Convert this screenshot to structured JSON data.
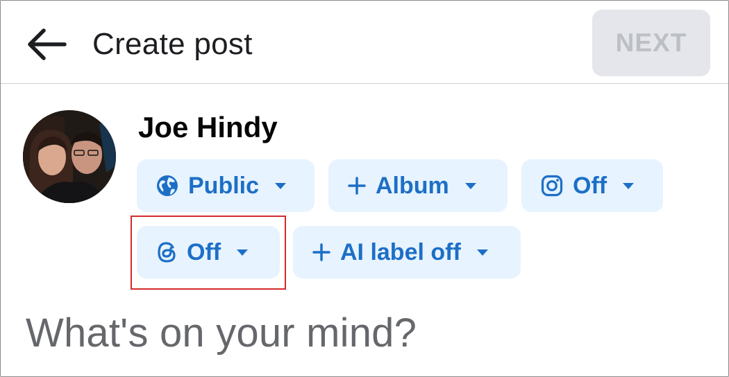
{
  "header": {
    "back_icon": "arrow-left-icon",
    "title": "Create post",
    "next_label": "NEXT"
  },
  "profile": {
    "name": "Joe Hindy",
    "avatar_icon": "profile-photo"
  },
  "audience_chips": [
    {
      "icon": "globe-icon",
      "label": "Public",
      "caret": "caret-down-icon"
    },
    {
      "icon": "plus-icon",
      "label": "Album",
      "caret": "caret-down-icon"
    },
    {
      "icon": "instagram-icon",
      "label": "Off",
      "caret": "caret-down-icon"
    },
    {
      "icon": "threads-icon",
      "label": "Off",
      "caret": "caret-down-icon"
    },
    {
      "icon": "plus-icon",
      "label": "AI label off",
      "caret": "caret-down-icon"
    }
  ],
  "composer": {
    "placeholder": "What's on your mind?"
  },
  "colors": {
    "chip_background": "#e7f3ff",
    "chip_text": "#1d6fc6",
    "next_background": "#e4e6eb",
    "next_text": "#bcc0c4",
    "highlight": "#d42a2a"
  }
}
